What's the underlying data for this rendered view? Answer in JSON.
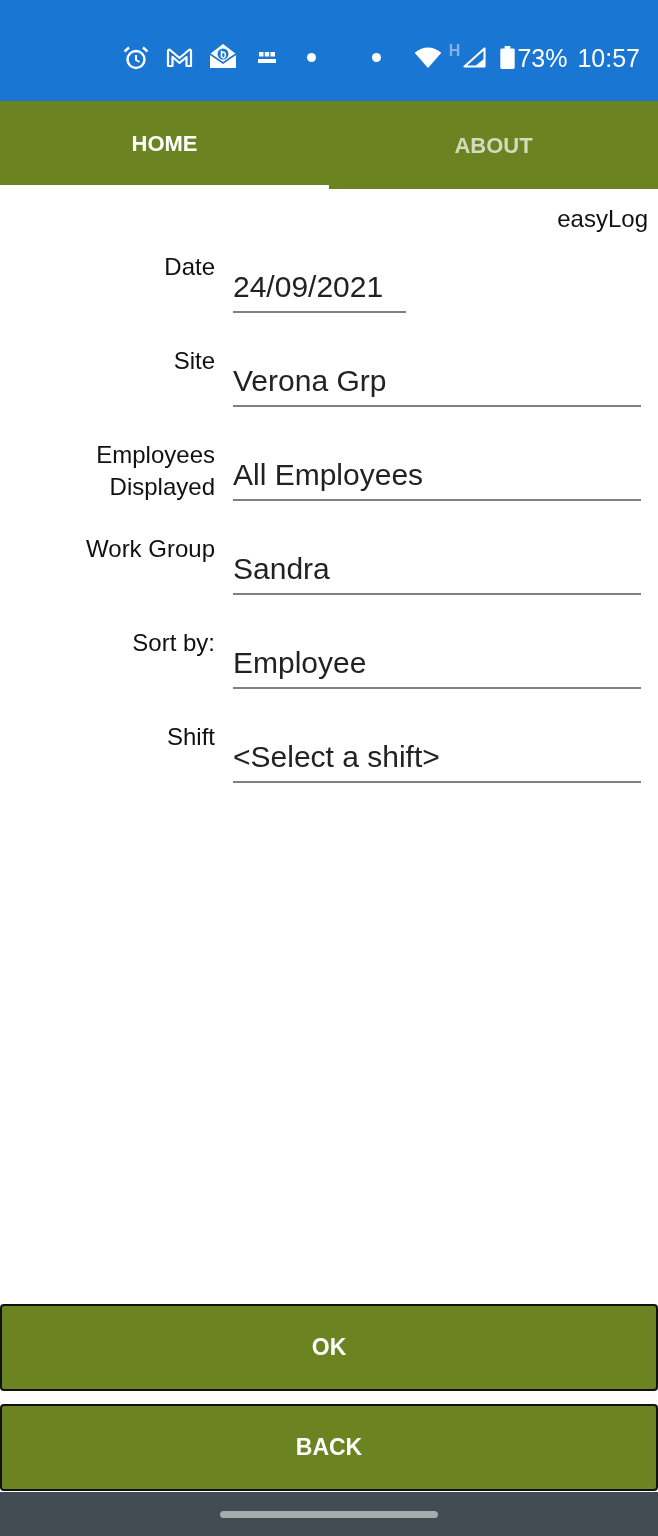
{
  "status_bar": {
    "network_letter": "H",
    "battery": "73%",
    "time": "10:57"
  },
  "tabs": [
    {
      "label": "HOME",
      "selected": true
    },
    {
      "label": "ABOUT",
      "selected": false
    }
  ],
  "app_label": "easyLog",
  "form": [
    {
      "label": "Date",
      "value": "24/09/2021",
      "kind": "date"
    },
    {
      "label": "Site",
      "value": "Verona Grp",
      "kind": "picker"
    },
    {
      "label": "Employees Displayed",
      "value": "All Employees",
      "kind": "picker"
    },
    {
      "label": "Work Group",
      "value": "Sandra",
      "kind": "picker"
    },
    {
      "label": "Sort by:",
      "value": "Employee",
      "kind": "picker"
    },
    {
      "label": "Shift",
      "value": "<Select a shift>",
      "kind": "picker"
    }
  ],
  "buttons": [
    "OK",
    "BACK"
  ]
}
